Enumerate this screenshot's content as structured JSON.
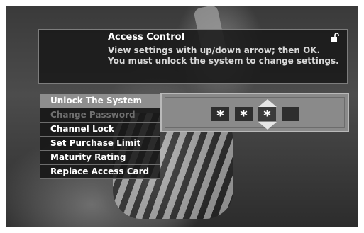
{
  "header": {
    "title": "Access Control",
    "line1": "View settings with up/down arrow; then OK.",
    "line2": "You must unlock the system to change settings.",
    "icon": "unlocked-padlock-icon"
  },
  "menu": {
    "items": [
      {
        "label": "Unlock The System",
        "state": "selected"
      },
      {
        "label": "Change Password",
        "state": "disabled"
      },
      {
        "label": "Channel Lock",
        "state": "normal"
      },
      {
        "label": "Set Purchase Limit",
        "state": "normal"
      },
      {
        "label": "Maturity Rating",
        "state": "normal"
      },
      {
        "label": "Replace Access Card",
        "state": "normal"
      }
    ]
  },
  "pin": {
    "digits": [
      "*",
      "*",
      "*",
      ""
    ],
    "active_index": 2
  }
}
